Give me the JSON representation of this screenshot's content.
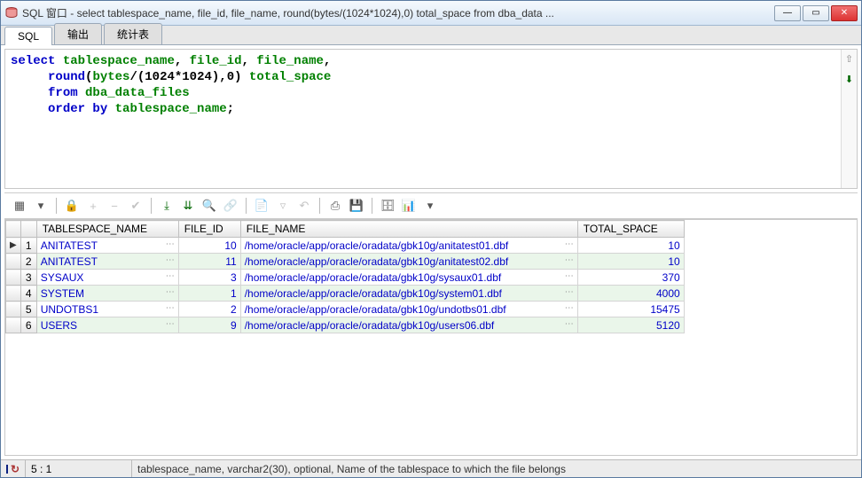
{
  "window": {
    "title": "SQL 窗口 - select tablespace_name, file_id, file_name, round(bytes/(1024*1024),0) total_space from dba_data ..."
  },
  "tabs": {
    "sql": "SQL",
    "output": "输出",
    "stats": "统计表"
  },
  "sql": {
    "l1_kw": "select",
    "l1_ids": " tablespace_name",
    "l1_c1": ", ",
    "l1_id2": "file_id",
    "l1_c2": ", ",
    "l1_id3": "file_name",
    "l1_end": ",",
    "l2_pad": "     ",
    "l2_fn": "round",
    "l2_p1": "(",
    "l2_id": "bytes",
    "l2_op": "/(",
    "l2_n1": "1024",
    "l2_st": "*",
    "l2_n2": "1024",
    "l2_cl": "),",
    "l2_n3": "0",
    "l2_p2": ") ",
    "l2_al": "total_space",
    "l3_pad": "     ",
    "l3_kw": "from",
    "l3_sp": " ",
    "l3_id": "dba_data_files",
    "l4_pad": "     ",
    "l4_kw": "order by",
    "l4_sp": " ",
    "l4_id": "tablespace_name",
    "l4_end": ";"
  },
  "headers": {
    "ts": "TABLESPACE_NAME",
    "fid": "FILE_ID",
    "fn": "FILE_NAME",
    "tot": "TOTAL_SPACE"
  },
  "rows": [
    {
      "n": "1",
      "ts": "ANITATEST",
      "fid": "10",
      "fn": "/home/oracle/app/oracle/oradata/gbk10g/anitatest01.dbf",
      "tot": "10"
    },
    {
      "n": "2",
      "ts": "ANITATEST",
      "fid": "11",
      "fn": "/home/oracle/app/oracle/oradata/gbk10g/anitatest02.dbf",
      "tot": "10"
    },
    {
      "n": "3",
      "ts": "SYSAUX",
      "fid": "3",
      "fn": "/home/oracle/app/oracle/oradata/gbk10g/sysaux01.dbf",
      "tot": "370"
    },
    {
      "n": "4",
      "ts": "SYSTEM",
      "fid": "1",
      "fn": "/home/oracle/app/oracle/oradata/gbk10g/system01.dbf",
      "tot": "4000"
    },
    {
      "n": "5",
      "ts": "UNDOTBS1",
      "fid": "2",
      "fn": "/home/oracle/app/oracle/oradata/gbk10g/undotbs01.dbf",
      "tot": "15475"
    },
    {
      "n": "6",
      "ts": "USERS",
      "fid": "9",
      "fn": "/home/oracle/app/oracle/oradata/gbk10g/users06.dbf",
      "tot": "5120"
    }
  ],
  "status": {
    "pos": "5 : 1",
    "info": "tablespace_name, varchar2(30), optional, Name of the tablespace to which the file belongs"
  }
}
